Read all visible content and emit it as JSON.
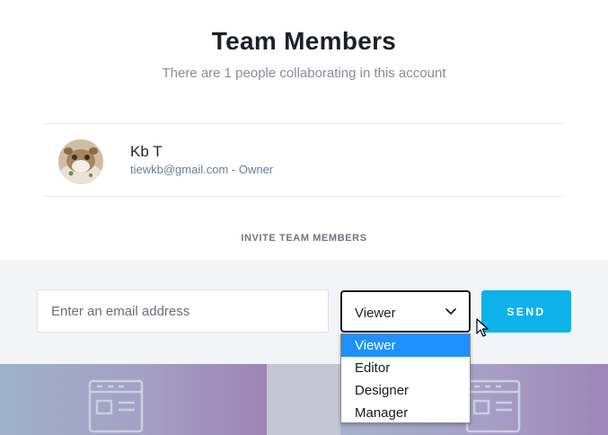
{
  "header": {
    "title": "Team Members",
    "subtitle": "There are 1 people collaborating in this account"
  },
  "members": [
    {
      "name": "Kb T",
      "meta": "tiewkb@gmail.com - Owner",
      "avatar_icon": "avatar-photo"
    }
  ],
  "invite": {
    "heading": "INVITE TEAM MEMBERS",
    "email_placeholder": "Enter an email address",
    "email_value": "",
    "role_selected": "Viewer",
    "role_options": [
      "Viewer",
      "Editor",
      "Designer",
      "Manager"
    ],
    "send_label": "SEND"
  },
  "colors": {
    "accent": "#0cb2e9",
    "option_highlight": "#1e90ff",
    "band": "#f3f4f6"
  },
  "icons": [
    "chevron-down-icon",
    "mouse-pointer-icon",
    "layout-template-icon"
  ]
}
